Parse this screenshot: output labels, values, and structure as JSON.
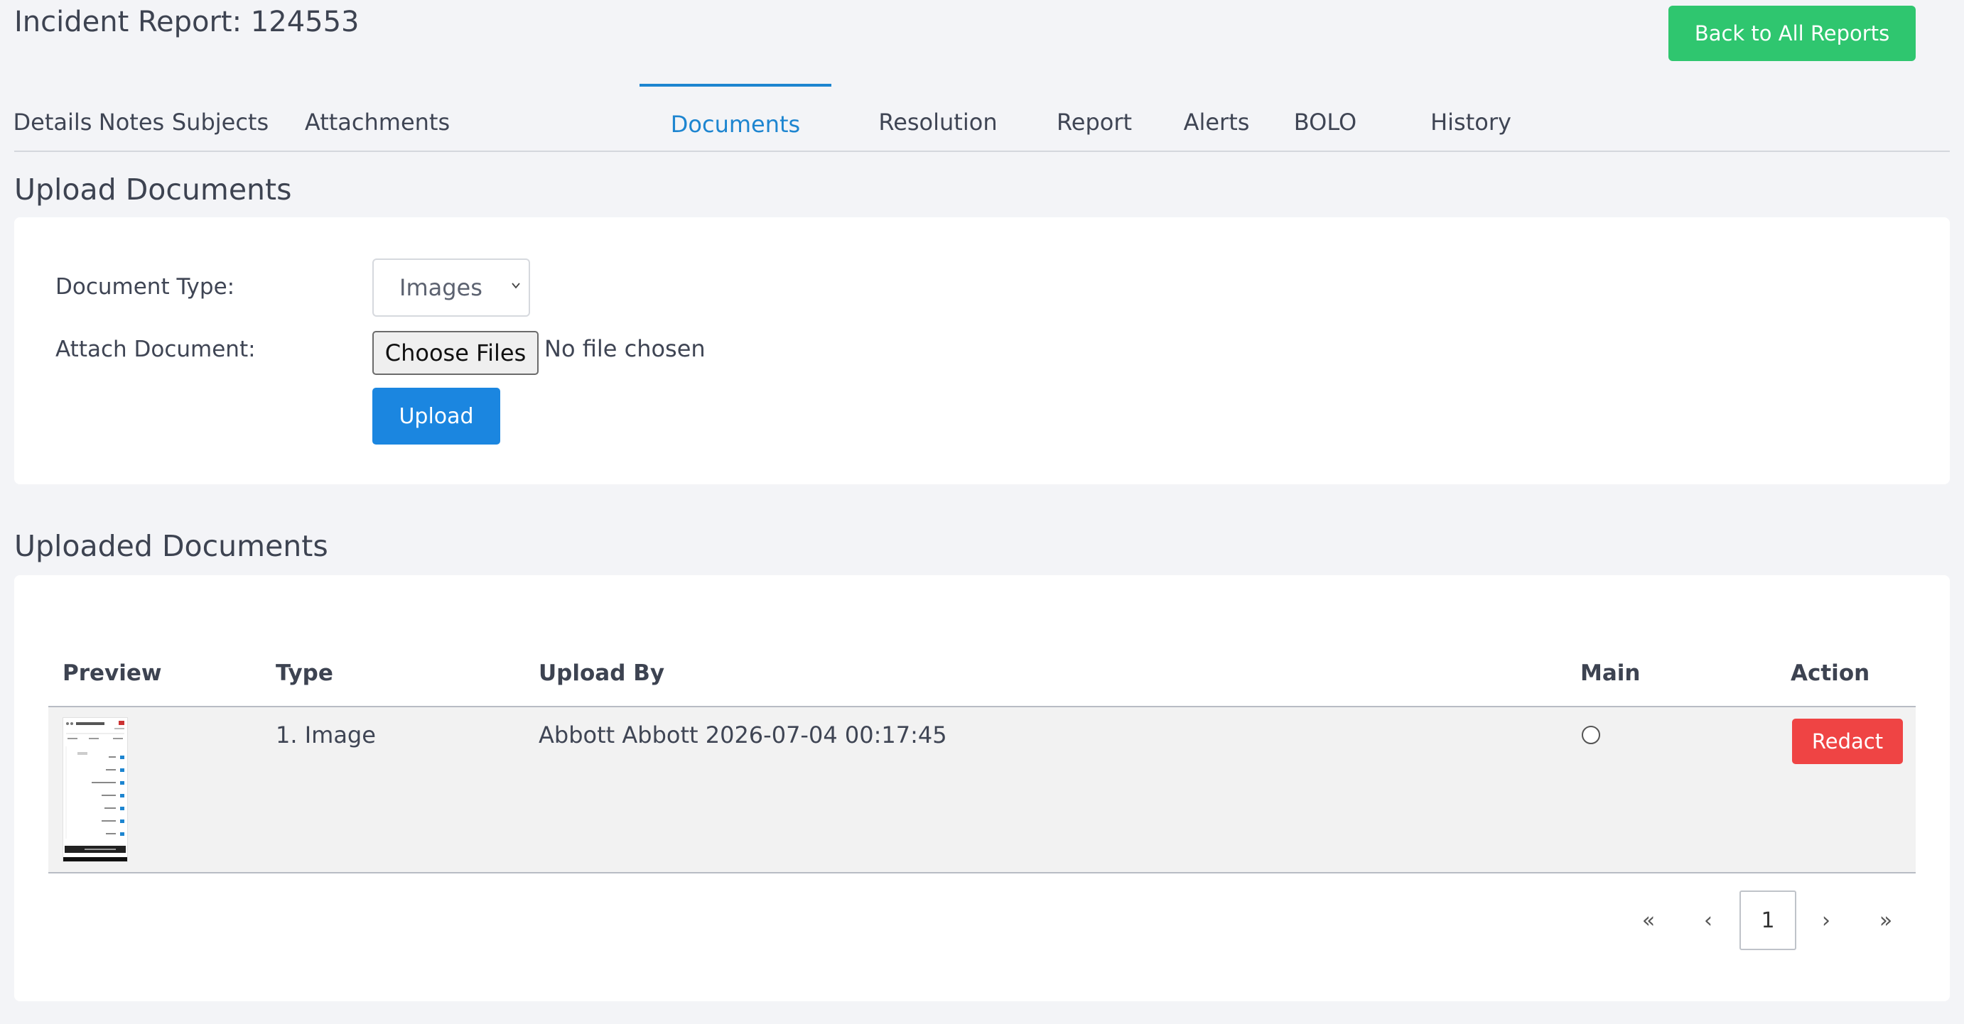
{
  "header": {
    "title": "Incident Report: 124553",
    "back_button": "Back to All Reports"
  },
  "tabs": [
    {
      "label": "Details"
    },
    {
      "label": "Notes"
    },
    {
      "label": "Subjects"
    },
    {
      "label": "Attachments"
    },
    {
      "label": "Documents",
      "active": true
    },
    {
      "label": "Resolution"
    },
    {
      "label": "Report"
    },
    {
      "label": "Alerts"
    },
    {
      "label": "BOLO"
    },
    {
      "label": "History"
    }
  ],
  "upload_section": {
    "title": "Upload Documents",
    "document_type_label": "Document Type:",
    "document_type_value": "Images",
    "attach_label": "Attach Document:",
    "choose_files_label": "Choose Files",
    "file_status": "No file chosen",
    "upload_button": "Upload"
  },
  "uploaded_section": {
    "title": "Uploaded Documents",
    "columns": [
      "Preview",
      "Type",
      "Upload By",
      "Main",
      "Action"
    ],
    "rows": [
      {
        "type": "1. Image",
        "upload_by": "Abbott Abbott 2026-07-04 00:17:45",
        "main_selected": false,
        "action": "Redact"
      }
    ]
  },
  "pagination": {
    "first": "«",
    "prev": "‹",
    "current": "1",
    "next": "›",
    "last": "»"
  },
  "colors": {
    "accent": "#1d85d0",
    "success": "#2fc66f",
    "danger": "#ef4444",
    "primary_button": "#1b86e0"
  },
  "icons": {
    "select_chevron": "chevron-down-icon",
    "radio": "radio-button-icon"
  }
}
